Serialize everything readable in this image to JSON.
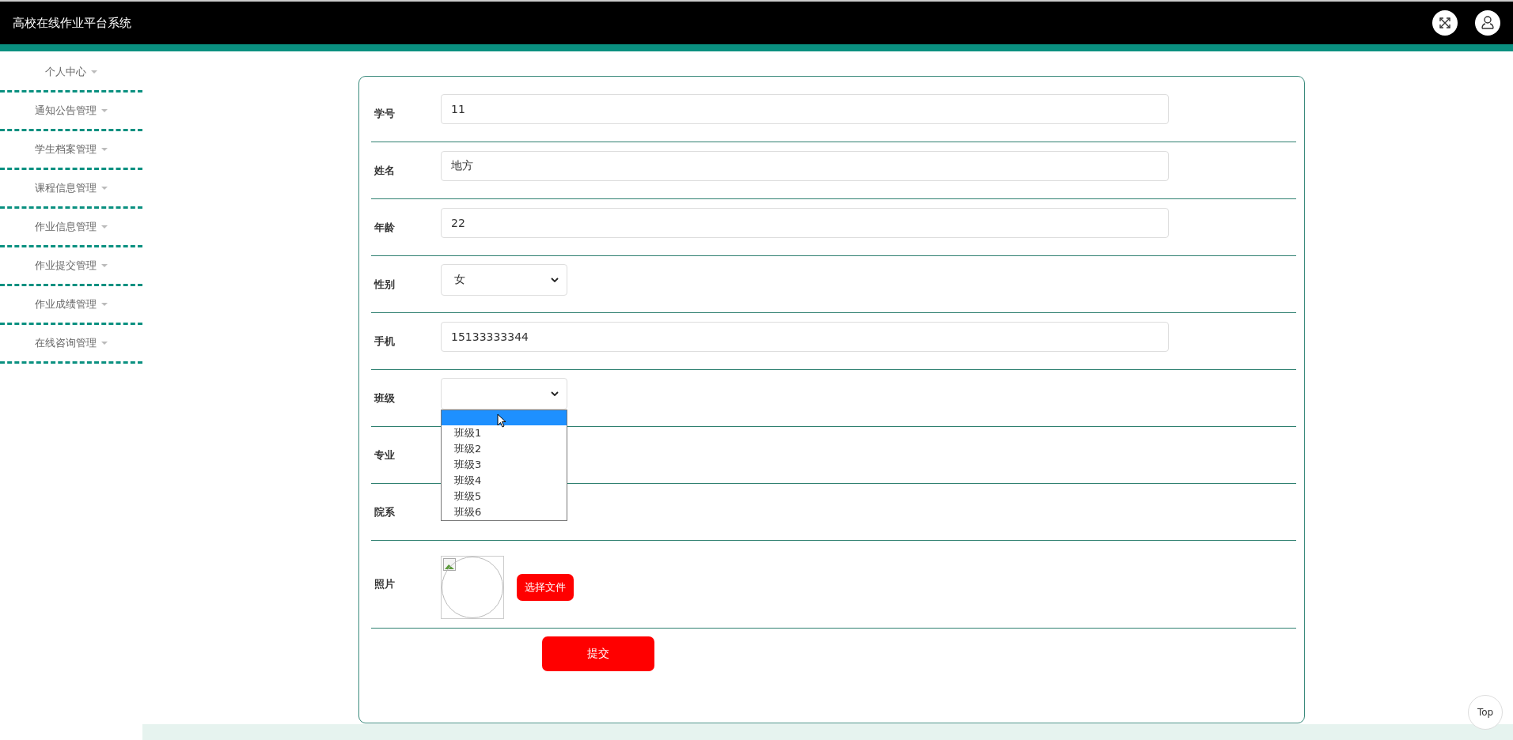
{
  "header": {
    "title": "高校在线作业平台系统"
  },
  "sidebar": {
    "items": [
      {
        "label": "个人中心"
      },
      {
        "label": "通知公告管理"
      },
      {
        "label": "学生档案管理"
      },
      {
        "label": "课程信息管理"
      },
      {
        "label": "作业信息管理"
      },
      {
        "label": "作业提交管理"
      },
      {
        "label": "作业成绩管理"
      },
      {
        "label": "在线咨询管理"
      }
    ]
  },
  "form": {
    "fields": [
      {
        "label": "学号",
        "kind": "text",
        "value": "11"
      },
      {
        "label": "姓名",
        "kind": "text",
        "value": "地方"
      },
      {
        "label": "年龄",
        "kind": "text",
        "value": "22"
      },
      {
        "label": "性别",
        "kind": "select",
        "value": "女"
      },
      {
        "label": "手机",
        "kind": "text",
        "value": "15133333344"
      },
      {
        "label": "班级",
        "kind": "select",
        "open": true,
        "blank_option_selected": true,
        "options": [
          {
            "label": "班级1",
            "selected": false
          },
          {
            "label": "班级2",
            "selected": false
          },
          {
            "label": "班级3",
            "selected": false
          },
          {
            "label": "班级4",
            "selected": false
          },
          {
            "label": "班级5",
            "selected": false
          },
          {
            "label": "班级6",
            "selected": false
          }
        ]
      },
      {
        "label": "专业",
        "kind": "covered"
      },
      {
        "label": "院系",
        "kind": "covered"
      },
      {
        "label": "照片",
        "kind": "photo",
        "button": "选择文件"
      }
    ],
    "submit": "提交"
  },
  "top_button": "Top"
}
